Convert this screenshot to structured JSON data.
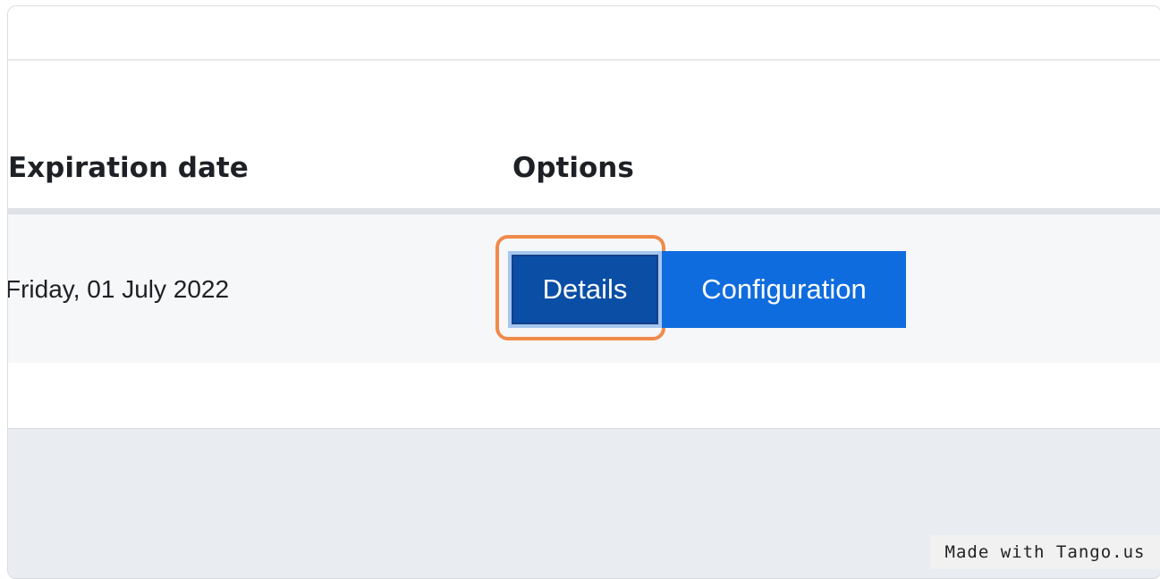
{
  "table": {
    "headers": {
      "expiration": "Expiration date",
      "options": "Options"
    },
    "rows": [
      {
        "expiration": "Friday, 01 July 2022",
        "actions": {
          "details_label": "Details",
          "configuration_label": "Configuration"
        }
      }
    ]
  },
  "watermark": "Made with Tango.us",
  "colors": {
    "details_button": "#0a4ea6",
    "configuration_button": "#0f6cde",
    "highlight_ring": "#f08a4b",
    "page_background": "#e9ecf1"
  }
}
